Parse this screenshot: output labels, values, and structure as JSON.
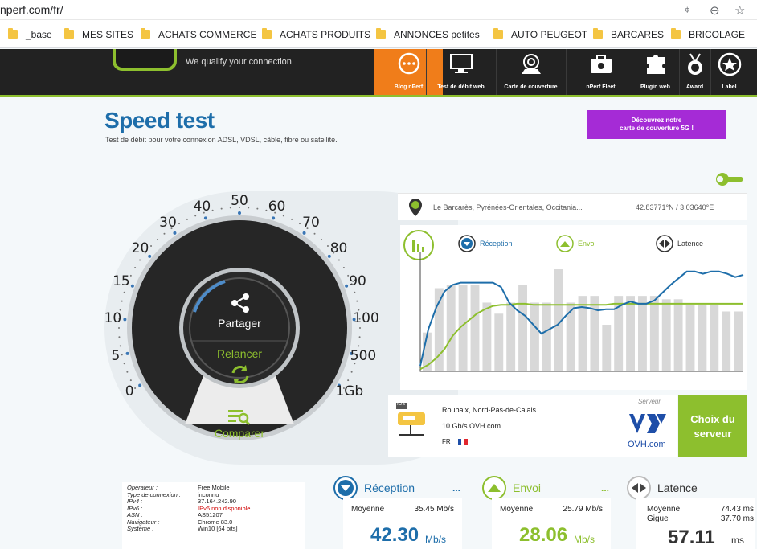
{
  "browser": {
    "url": "nperf.com/fr/",
    "bookmarks": [
      "_base",
      "MES SITES",
      "ACHATS COMMERCE",
      "ACHATS PRODUITS",
      "ANNONCES  petites",
      "AUTO PEUGEOT",
      "BARCARES",
      "BRICOLAGE"
    ]
  },
  "header": {
    "tagline": "We qualify your connection",
    "nav": [
      {
        "label": "Blog nPerf",
        "icon": "chat-bubble-icon",
        "active": true
      },
      {
        "label": "Test de débit web",
        "icon": "monitor-icon",
        "active": false
      },
      {
        "label": "Carte de couverture",
        "icon": "map-icon",
        "active": false
      },
      {
        "label": "nPerf Fleet",
        "icon": "toolbox-icon",
        "active": false
      },
      {
        "label": "Plugin web",
        "icon": "puzzle-icon",
        "active": false
      },
      {
        "label": "Award",
        "icon": "medal-icon",
        "active": false
      },
      {
        "label": "Label",
        "icon": "star-badge-icon",
        "active": false
      }
    ]
  },
  "page": {
    "title": "Speed test",
    "subtitle": "Test de débit pour votre connexion ADSL, VDSL, câble, fibre ou satellite.",
    "promo_line1": "Découvrez notre",
    "promo_line2": "carte de couverture 5G !"
  },
  "gauge": {
    "scale": [
      "0",
      "5",
      "10",
      "15",
      "20",
      "30",
      "40",
      "50",
      "60",
      "70",
      "80",
      "90",
      "100",
      "500",
      "1Gb"
    ],
    "share_label": "Partager",
    "restart_label": "Relancer",
    "compare_label": "Comparer"
  },
  "location": {
    "place": "Le Barcarès, Pyrénées-Orientales, Occitania...",
    "coords": "42.83771°N / 3.03640°E"
  },
  "legend": {
    "reception": "Réception",
    "envoi": "Envoi",
    "latence": "Latence"
  },
  "chart_data": {
    "type": "bar",
    "bars": [
      0.35,
      0.75,
      0.78,
      0.78,
      0.78,
      0.62,
      0.52,
      0.62,
      0.78,
      0.62,
      0.62,
      0.92,
      0.62,
      0.68,
      0.68,
      0.42,
      0.68,
      0.68,
      0.68,
      0.68,
      0.65,
      0.65,
      0.6,
      0.6,
      0.6,
      0.54,
      0.54
    ],
    "reception_line": [
      0.05,
      0.38,
      0.58,
      0.72,
      0.78,
      0.8,
      0.8,
      0.8,
      0.8,
      0.8,
      0.76,
      0.62,
      0.55,
      0.5,
      0.42,
      0.34,
      0.38,
      0.42,
      0.5,
      0.57,
      0.58,
      0.57,
      0.55,
      0.56,
      0.56,
      0.6,
      0.63,
      0.61,
      0.61,
      0.64,
      0.71,
      0.78,
      0.84,
      0.9,
      0.9,
      0.88,
      0.9,
      0.9,
      0.88,
      0.85,
      0.87
    ],
    "envoi_line": [
      0.02,
      0.06,
      0.12,
      0.2,
      0.32,
      0.4,
      0.46,
      0.52,
      0.56,
      0.59,
      0.6,
      0.6,
      0.61,
      0.61,
      0.6,
      0.6,
      0.6,
      0.6,
      0.6,
      0.6,
      0.6,
      0.6,
      0.6,
      0.6,
      0.61,
      0.61,
      0.61,
      0.61,
      0.61,
      0.61,
      0.61,
      0.61,
      0.61,
      0.61,
      0.61,
      0.61,
      0.61,
      0.61,
      0.61,
      0.61,
      0.61
    ]
  },
  "server": {
    "badge": "IOS",
    "label": "Serveur",
    "location": "Roubaix, Nord-Pas-de-Calais",
    "capacity": "10 Gb/s OVH.com",
    "country": "FR",
    "provider_logo": "OVH.com",
    "choose_line1": "Choix du",
    "choose_line2": "serveur"
  },
  "connection_info": [
    {
      "k": "Opérateur :",
      "v": "Free Mobile",
      "color": "#222"
    },
    {
      "k": "Type de connexion :",
      "v": "inconnu",
      "color": "#222"
    },
    {
      "k": "IPv4 :",
      "v": "37.164.242.90",
      "color": "#222"
    },
    {
      "k": "IPv6 :",
      "v": "IPv6 non disponible",
      "color": "#d00000"
    },
    {
      "k": "ASN :",
      "v": "AS51207",
      "color": "#222"
    },
    {
      "k": "Navigateur :",
      "v": "Chrome 83.0",
      "color": "#222"
    },
    {
      "k": "Système :",
      "v": "Win10 [64 bits]",
      "color": "#222"
    }
  ],
  "stats": {
    "reception": {
      "label": "Réception",
      "avg_label": "Moyenne",
      "avg_value": "35.45 Mb/s",
      "big": "42.30",
      "unit": "Mb/s",
      "color": "#1e6eaa",
      "dots": "..."
    },
    "envoi": {
      "label": "Envoi",
      "avg_label": "Moyenne",
      "avg_value": "25.79 Mb/s",
      "big": "28.06",
      "unit": "Mb/s",
      "color": "#8dbf2e",
      "dots": "..."
    },
    "latence": {
      "label": "Latence",
      "avg_label": "Moyenne",
      "avg_value": "74.43 ms",
      "jitter_label": "Gigue",
      "jitter_value": "37.70 ms",
      "big": "57.11",
      "unit": "ms",
      "color": "#333"
    }
  },
  "colors": {
    "blue": "#1e6eaa",
    "green": "#8dbf2e",
    "orange": "#f07d1a",
    "purple": "#a52bd6",
    "bar": "#d8d8d8"
  }
}
